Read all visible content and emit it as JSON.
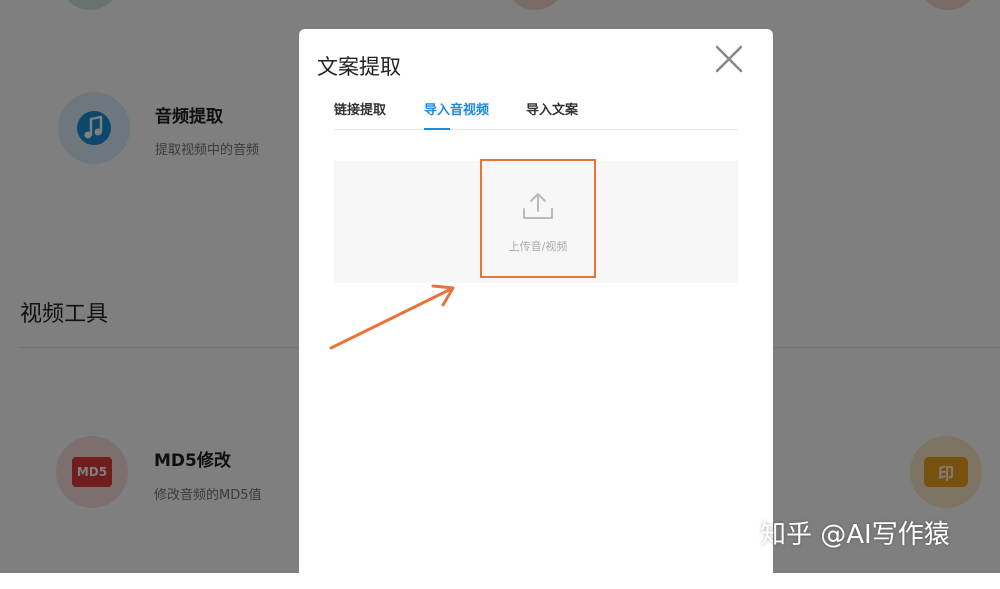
{
  "background": {
    "tools": [
      {
        "title": "音频提取",
        "desc": "提取视频中的音频",
        "icon": "music-note-icon",
        "color": "#1a8fd8"
      },
      {
        "title": "MD5修改",
        "desc": "修改音频的MD5值",
        "icon": "md5-icon",
        "color": "#e03b3b"
      }
    ],
    "md5_badge": "MD5",
    "right_icon_text": "印",
    "section_title": "视频工具"
  },
  "modal": {
    "title": "文案提取",
    "tabs": [
      {
        "label": "链接提取"
      },
      {
        "label": "导入音视频",
        "active": true
      },
      {
        "label": "导入文案"
      }
    ],
    "upload_label": "上传音/视频"
  },
  "watermark": "知乎 @AI写作猿",
  "colors": {
    "accent": "#1e88e5",
    "highlight": "#e8743b",
    "overlay": "rgba(0,0,0,0.5)"
  }
}
